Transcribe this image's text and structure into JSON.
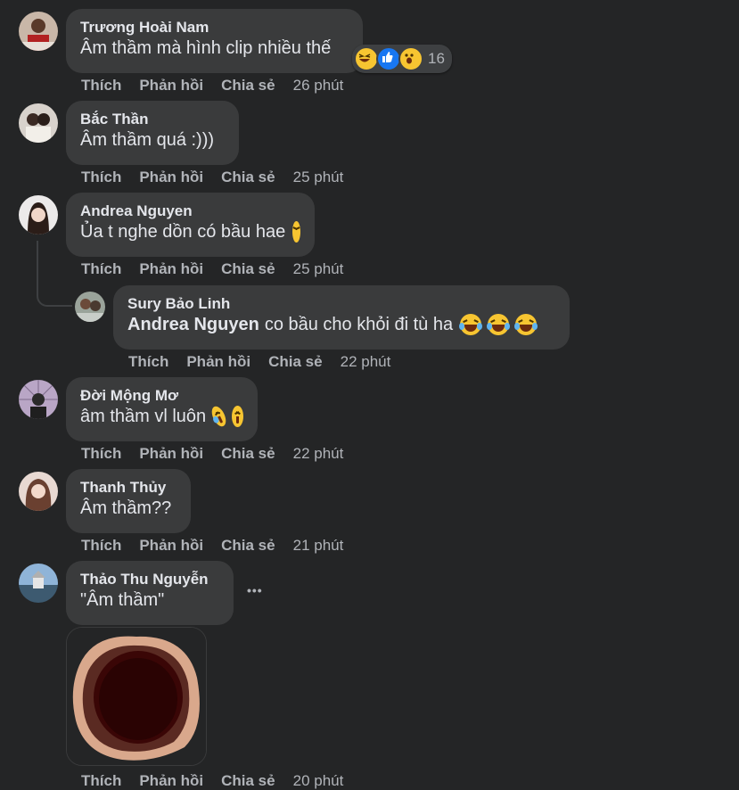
{
  "actions": {
    "like": "Thích",
    "reply": "Phản hồi",
    "share": "Chia sẻ"
  },
  "comments": [
    {
      "author": "Trương Hoài Nam",
      "text": "Âm thầm mà hình clip nhiều thế",
      "reaction_count": "16",
      "time": "26 phút"
    },
    {
      "author": "Bắc Thần",
      "text": "Âm thầm quá :)))",
      "time": "25 phút"
    },
    {
      "author": "Andrea Nguyen",
      "text": "Ủa t nghe dồn có bầu hae",
      "time": "25 phút"
    },
    {
      "author": "Sury Bảo Linh",
      "mention": "Andrea Nguyen",
      "text": "co bầu cho khỏi đi tù ha",
      "time": "22 phút"
    },
    {
      "author": "Đời Mộng Mơ",
      "text": "âm thầm vl luôn",
      "time": "22 phút"
    },
    {
      "author": "Thanh Thủy",
      "text": "Âm thầm??",
      "time": "21 phút"
    },
    {
      "author": "Thảo Thu Nguyễn",
      "text": "\"Âm thầm\"",
      "more": "•••",
      "time": "20 phút"
    }
  ],
  "colors": {
    "background": "#242526",
    "bubble": "#3a3b3c",
    "text": "#e4e6eb",
    "secondary": "#b0b3b8"
  },
  "icons": [
    "haha-emoji",
    "like-reaction",
    "wow-reaction",
    "laugh-cry-emoji",
    "more-options-icon"
  ]
}
